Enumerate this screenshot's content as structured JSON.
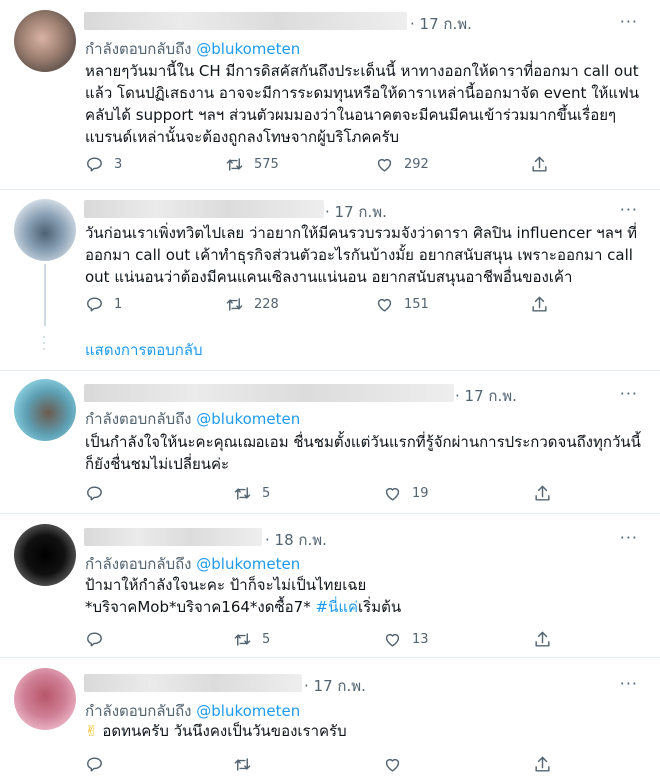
{
  "reply_prefix": "กำลังตอบกลับถึง",
  "tweets": [
    {
      "date": "· 17 ก.พ.",
      "reply_handle": "@blukometen",
      "text": "หลายๆวันมานี้ใน CH มีการดิสคัสกันถึงประเด็นนี้ หาทางออกให้ดาราที่ออกมา call out แล้ว โดนปฏิเสธงาน อาจจะมีการระดมทุนหรือให้ดาราเหล่านี้ออกมาจัด event ให้แฟนคลับได้ support ฯลฯ ส่วนตัวผมมองว่าในอนาคตจะมีคนมีคนเข้าร่วมมากขึ้นเรื่อยๆ แบรนด์เหล่านั้นจะต้องถูกลงโทษจากผู้บริโภคครับ",
      "replies": "3",
      "retweets": "575",
      "likes": "292"
    },
    {
      "date": "· 17 ก.พ.",
      "text": "วันก่อนเราเพิ่งทวิตไปเลย ว่าอยากให้มีคนรวบรวมจังว่าดารา ศิลปิน influencer ฯลฯ ที่ออกมา call out เค้าทำธุรกิจส่วนตัวอะไรกันบ้างมั้ย อยากสนับสนุน เพราะออกมา call out แน่นอนว่าต้องมีคนแคนเซิลงานแน่นอน อยากสนับสนุนอาชีพอื่นของเค้า",
      "replies": "1",
      "retweets": "228",
      "likes": "151"
    },
    {
      "date": "· 17 ก.พ.",
      "reply_handle": "@blukometen",
      "text": "เป็นกำลังใจให้นะคะคุณเฌอเอม ชื่นชมตั้งแต่วันแรกที่รู้จักผ่านการประกวดจนถึงทุกวันนี้ก็ยังชื่นชมไม่เปลี่ยนค่ะ",
      "replies": "",
      "retweets": "5",
      "likes": "19"
    },
    {
      "date": "· 18 ก.พ.",
      "reply_handle": "@blukometen",
      "text_line1": "ป้ามาให้กำลังใจนะคะ ป้าก็จะไม่เป็นไทยเฉย",
      "text_line2": "*บริจาคMob*บริจาค164*งดซื้อ7* ",
      "hashtag": "#นี่แค่",
      "text_after": "เริ่มต้น",
      "replies": "",
      "retweets": "5",
      "likes": "13"
    },
    {
      "date": "· 17 ก.พ.",
      "reply_handle": "@blukometen",
      "emoji": "✌",
      "text": " อดทนครับ วันนึงคงเป็นวันของเราครับ",
      "replies": "",
      "retweets": "",
      "likes": ""
    }
  ],
  "show_replies": "แสดงการตอบกลับ",
  "icons": [
    "reply-icon",
    "retweet-icon",
    "like-icon",
    "share-icon",
    "more-icon"
  ],
  "colors": {
    "link": "#1d9bf0",
    "secondary": "#536471",
    "divider": "#e6ecf0"
  }
}
